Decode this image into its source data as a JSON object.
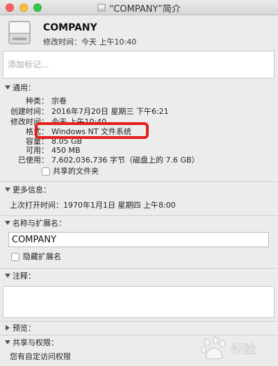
{
  "window": {
    "title": "“COMPANY”简介"
  },
  "header": {
    "name": "COMPANY",
    "modified": "修改时间：今天 上午10:40"
  },
  "tags": {
    "placeholder": "添加标记..."
  },
  "general": {
    "title": "通用：",
    "kind_label": "种类：",
    "kind_value": "宗卷",
    "created_label": "创建时间：",
    "created_value": "2016年7月20日 星期三 下午6:21",
    "modified_label": "修改时间：",
    "modified_value": "今天 上午10:40",
    "format_label": "格式：",
    "format_value": "Windows NT 文件系统",
    "capacity_label": "容量：",
    "capacity_value": "8.05 GB",
    "available_label": "可用：",
    "available_value": "450 MB",
    "used_label": "已使用：",
    "used_value": "7,602,036,736 字节（磁盘上的 7.6 GB）",
    "shared_label": "共享的文件夹"
  },
  "more_info": {
    "title": "更多信息：",
    "last_opened": "上次打开时间：1970年1月1日 星期四 上午8:00"
  },
  "name_ext": {
    "title": "名称与扩展名：",
    "value": "COMPANY",
    "hide_ext_label": "隐藏扩展名"
  },
  "comments": {
    "title": "注释："
  },
  "preview": {
    "title": "预览："
  },
  "sharing": {
    "title": "共享与权限：",
    "status": "您有自定访问权限"
  },
  "watermark": {
    "text": "经验"
  },
  "colors": {
    "highlight": "#e2201c",
    "window_bg": "#ececec"
  }
}
